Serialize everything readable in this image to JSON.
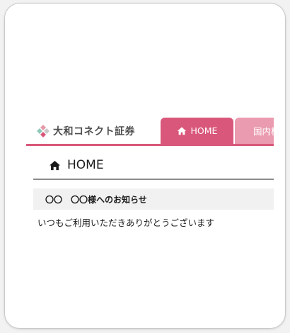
{
  "header": {
    "logo_text": "大和コネクト証券",
    "logo_icon": "diamond-logo-mark",
    "tabs": [
      {
        "label": "HOME",
        "icon": "home-icon",
        "active": true
      },
      {
        "label": "国内株",
        "active": false
      }
    ]
  },
  "main": {
    "page_title": "HOME",
    "page_title_icon": "home-icon",
    "notice": {
      "title": "〇〇　〇〇様へのお知らせ",
      "body": "いつもご利用いただきありがとうございます"
    }
  },
  "colors": {
    "brand_pink": "#d9577a",
    "tab_light_pink": "#ea9bb0",
    "notice_bg": "#f1f1f1",
    "rule_gray": "#8c8c8c"
  }
}
